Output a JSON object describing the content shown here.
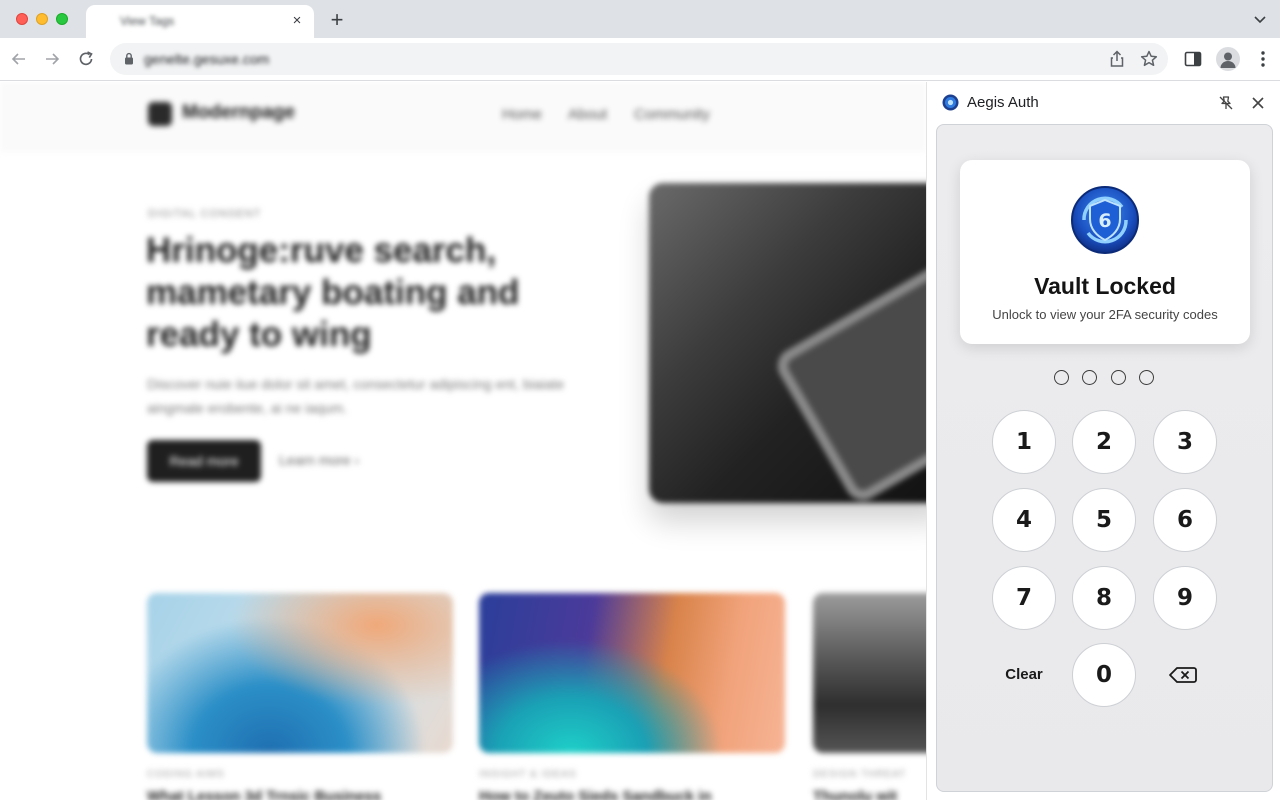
{
  "browser": {
    "tab_title": "View Tags",
    "tab_close": "×",
    "new_tab": "+",
    "url": "genelte.gesuxe.com"
  },
  "page": {
    "logo": "Modernpage",
    "nav": [
      "Home",
      "About",
      "Community"
    ],
    "eyebrow": "DIGITAL CONSENT",
    "hero_title": "Hrinoge:ruve search, mametary boating and ready to wing",
    "hero_sub": "Discover nuie iiue dolor sit amet, consectetur adipiscing ent, biaiate aingmale erobente, ai ne iaqum.",
    "primary_button": "Read more",
    "secondary_link": "Learn more ›",
    "cards": [
      {
        "tag": "CODING AIMS",
        "title": "What Lesson 3d Trnsic Business"
      },
      {
        "tag": "INSIGHT & IDEAS",
        "title": "How to Zeuto Sieds Sandbuck in"
      },
      {
        "tag": "DESIGN THREAT",
        "title": "Thunolu wit"
      }
    ]
  },
  "extension": {
    "title": "Aegis Auth",
    "logo_icon": "aegis-shield-icon",
    "vault_title": "Vault Locked",
    "vault_subtitle": "Unlock to view your 2FA security codes",
    "pin_length": 4,
    "pin_entered": 0,
    "keys": [
      "1",
      "2",
      "3",
      "4",
      "5",
      "6",
      "7",
      "8",
      "9",
      "0"
    ],
    "clear_label": "Clear",
    "accent_color": "#1f5fd6"
  }
}
